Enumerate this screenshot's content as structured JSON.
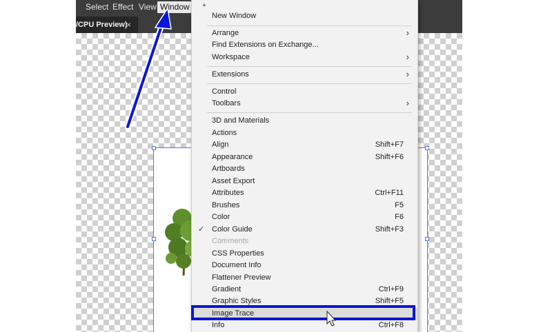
{
  "menubar": {
    "items": [
      "Select",
      "Effect",
      "View",
      "Window"
    ]
  },
  "tab": {
    "title": "/CPU Preview)",
    "close": "×"
  },
  "menu": {
    "scroll_glyph": "▲",
    "checkmark": "✓",
    "submenu_arrow": "›",
    "items": [
      {
        "label": "New Window",
        "shortcut": ""
      },
      {
        "label": "Arrange",
        "shortcut": ""
      },
      {
        "label": "Find Extensions on Exchange...",
        "shortcut": ""
      },
      {
        "label": "Workspace",
        "shortcut": ""
      },
      {
        "label": "Extensions",
        "shortcut": ""
      },
      {
        "label": "Control",
        "shortcut": ""
      },
      {
        "label": "Toolbars",
        "shortcut": ""
      },
      {
        "label": "3D and Materials",
        "shortcut": ""
      },
      {
        "label": "Actions",
        "shortcut": ""
      },
      {
        "label": "Align",
        "shortcut": "Shift+F7"
      },
      {
        "label": "Appearance",
        "shortcut": "Shift+F6"
      },
      {
        "label": "Artboards",
        "shortcut": ""
      },
      {
        "label": "Asset Export",
        "shortcut": ""
      },
      {
        "label": "Attributes",
        "shortcut": "Ctrl+F11"
      },
      {
        "label": "Brushes",
        "shortcut": "F5"
      },
      {
        "label": "Color",
        "shortcut": "F6"
      },
      {
        "label": "Color Guide",
        "shortcut": "Shift+F3"
      },
      {
        "label": "Comments",
        "shortcut": ""
      },
      {
        "label": "CSS Properties",
        "shortcut": ""
      },
      {
        "label": "Document Info",
        "shortcut": ""
      },
      {
        "label": "Flattener Preview",
        "shortcut": ""
      },
      {
        "label": "Gradient",
        "shortcut": "Ctrl+F9"
      },
      {
        "label": "Graphic Styles",
        "shortcut": "Shift+F5"
      },
      {
        "label": "Image Trace",
        "shortcut": ""
      },
      {
        "label": "Info",
        "shortcut": "Ctrl+F8"
      }
    ]
  },
  "colors": {
    "highlight_box": "#0a16d9",
    "arrow": "#0a16d9",
    "selection": "#4b79e6"
  },
  "icons": {
    "cursor": "arrow-pointer-icon"
  }
}
